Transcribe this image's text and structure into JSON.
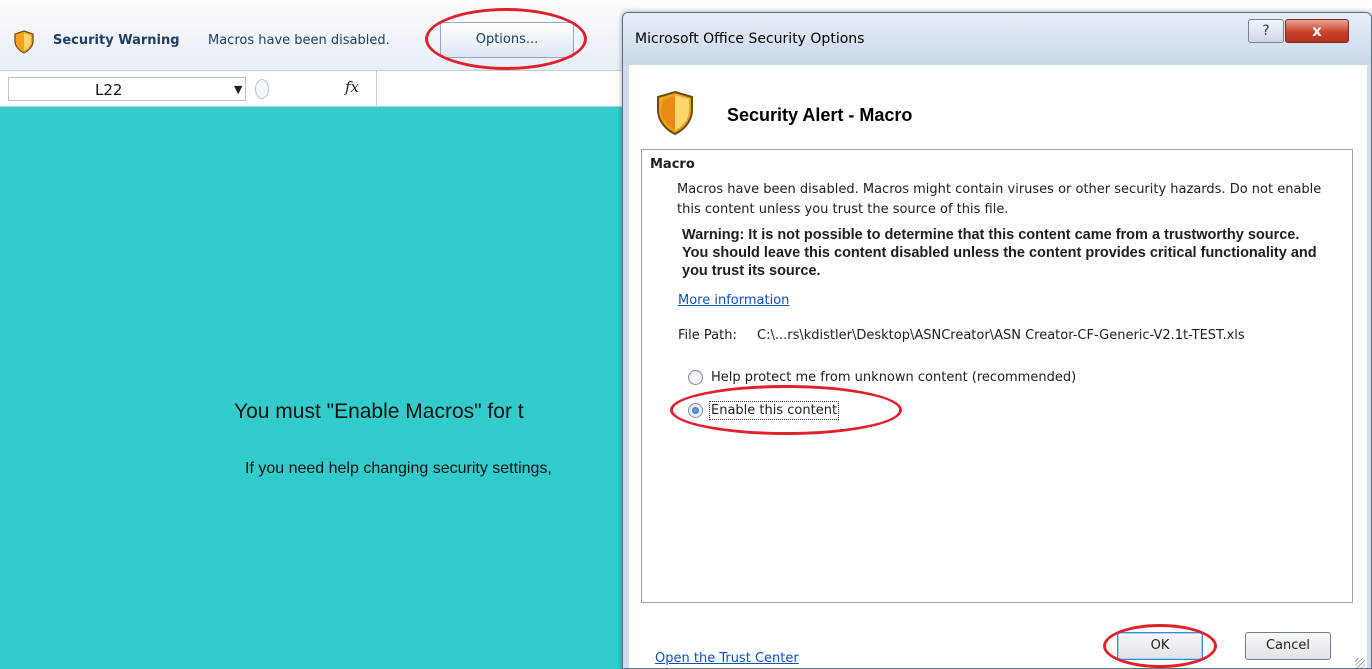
{
  "excel": {
    "message_bar": {
      "shield_icon": "security-shield-icon",
      "title": "Security Warning",
      "text": "Macros have been disabled.",
      "options_button": "Options..."
    },
    "formula_bar": {
      "name_box": "L22",
      "fx_label": "fx"
    },
    "sheet": {
      "background_color": "#33cccc",
      "main_text": "You must \"Enable Macros\" for t",
      "help_text": "If you need help changing security settings,"
    }
  },
  "dialog": {
    "title": "Microsoft Office Security Options",
    "help_button": "?",
    "close_button": "x",
    "alert_title": "Security Alert - Macro",
    "group": {
      "title": "Macro",
      "description": "Macros have been disabled. Macros might contain viruses or other security hazards. Do not enable this content unless you trust the source of this file.",
      "warning": "Warning: It is not possible to determine that this content came from a trustworthy source. You should leave this content disabled unless the content provides critical functionality and you trust its source.",
      "more_info_link": "More information",
      "file_path_label": "File Path:",
      "file_path_value": "C:\\...rs\\kdistler\\Desktop\\ASNCreator\\ASN Creator-CF-Generic-V2.1t-TEST.xls"
    },
    "options": [
      {
        "label": "Help protect me from unknown content (recommended)",
        "selected": false
      },
      {
        "label": "Enable this content",
        "selected": true
      }
    ],
    "trust_center_link": "Open the Trust Center",
    "ok_button": "OK",
    "cancel_button": "Cancel"
  },
  "colors": {
    "annotation_red": "#e3202a",
    "link_blue": "#0f4fb8"
  }
}
